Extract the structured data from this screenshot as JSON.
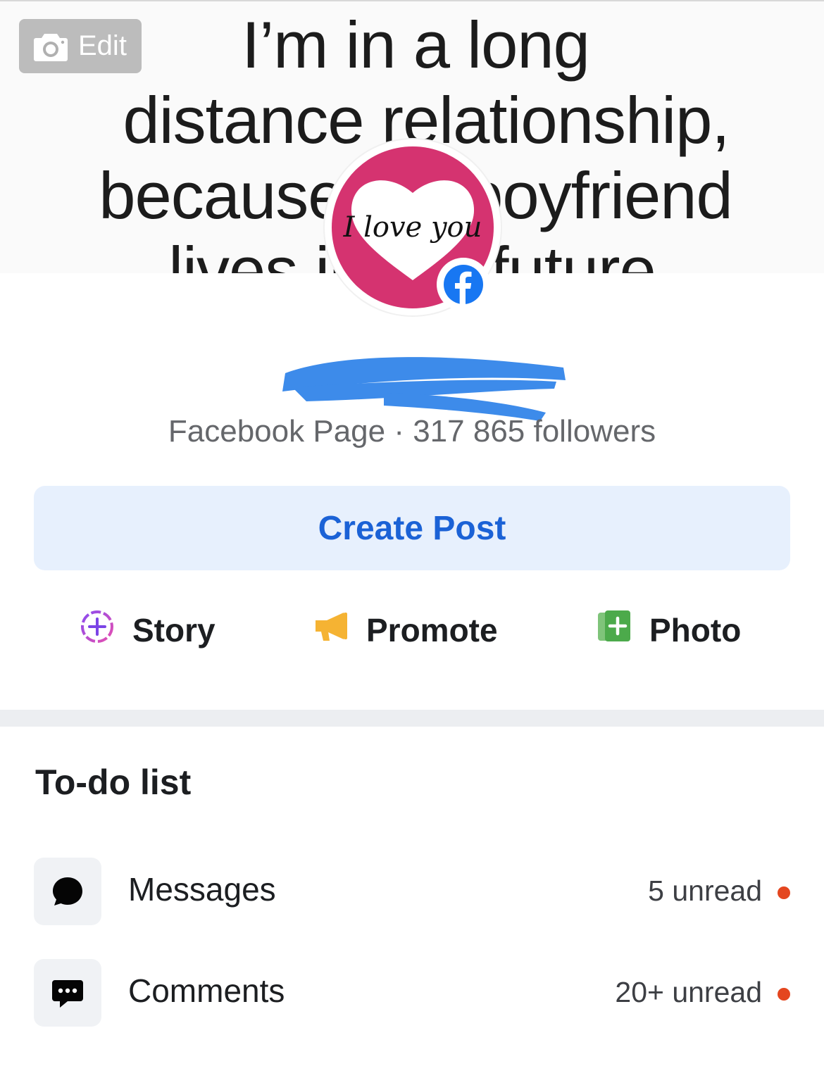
{
  "cover": {
    "lines": [
      "I’m in a long",
      "distance relationship,",
      "because my boyfriend",
      "lives in the future"
    ],
    "edit_label": "Edit"
  },
  "avatar": {
    "text": "I love you",
    "background_color": "#d53370"
  },
  "page": {
    "meta": "Facebook Page · 317 865 followers"
  },
  "create_post": {
    "label": "Create Post"
  },
  "actions": [
    {
      "label": "Story",
      "icon": "story-add-icon"
    },
    {
      "label": "Promote",
      "icon": "megaphone-icon"
    },
    {
      "label": "Photo",
      "icon": "photo-add-icon"
    }
  ],
  "todo": {
    "title": "To-do list",
    "items": [
      {
        "label": "Messages",
        "count": "5 unread",
        "icon": "message-bubble-icon"
      },
      {
        "label": "Comments",
        "count": "20+ unread",
        "icon": "comment-bubble-icon"
      }
    ]
  },
  "colors": {
    "accent": "#1b62d6",
    "create_post_bg": "#e7f0fd",
    "unread_dot": "#e4461f",
    "facebook_blue": "#1877f2"
  }
}
